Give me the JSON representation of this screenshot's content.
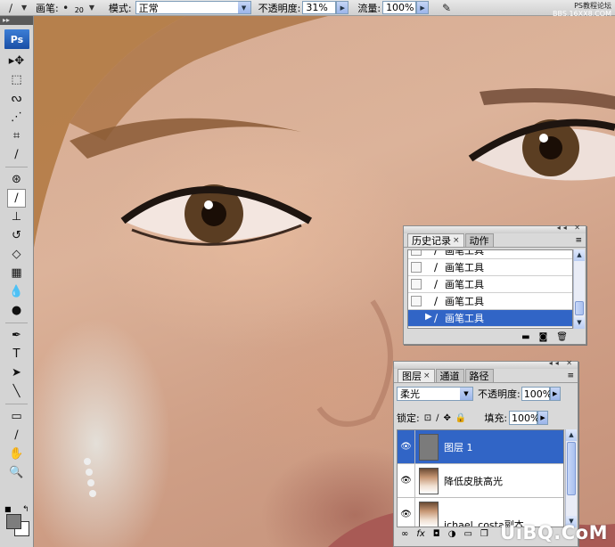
{
  "options_bar": {
    "tool_icon": "brush-icon",
    "brush_label": "画笔:",
    "brush_size": "20",
    "mode_label": "模式:",
    "mode_value": "正常",
    "opacity_label": "不透明度:",
    "opacity_value": "31%",
    "flow_label": "流量:",
    "flow_value": "100%",
    "airbrush_icon": "airbrush-icon"
  },
  "watermark_top": {
    "line1": "PS教程论坛",
    "line2": "BBS.16XX8.COM"
  },
  "tools": {
    "logo": "Ps",
    "grip": "▸▸",
    "items": [
      {
        "name": "move-tool",
        "icon": "▸✥"
      },
      {
        "name": "marquee-tool",
        "icon": "⬚"
      },
      {
        "name": "lasso-tool",
        "icon": "ᔓ"
      },
      {
        "name": "magic-wand-tool",
        "icon": "⋰"
      },
      {
        "name": "crop-tool",
        "icon": "⌗"
      },
      {
        "name": "eyedropper-tool",
        "icon": "∕"
      },
      {
        "name": "healing-tool",
        "icon": "⊛"
      },
      {
        "name": "brush-tool",
        "icon": "∕",
        "active": true
      },
      {
        "name": "stamp-tool",
        "icon": "⊥"
      },
      {
        "name": "history-brush-tool",
        "icon": "↺"
      },
      {
        "name": "eraser-tool",
        "icon": "◇"
      },
      {
        "name": "gradient-tool",
        "icon": "▦"
      },
      {
        "name": "blur-tool",
        "icon": "💧"
      },
      {
        "name": "dodge-tool",
        "icon": "●"
      },
      {
        "name": "pen-tool",
        "icon": "✒"
      },
      {
        "name": "type-tool",
        "icon": "T"
      },
      {
        "name": "path-selection-tool",
        "icon": "➤"
      },
      {
        "name": "line-tool",
        "icon": "╲"
      },
      {
        "name": "notes-tool",
        "icon": "▭"
      },
      {
        "name": "eyedropper-tool-2",
        "icon": "∕"
      },
      {
        "name": "hand-tool",
        "icon": "✋"
      },
      {
        "name": "zoom-tool",
        "icon": "🔍"
      }
    ],
    "foreground_color": "#7d7d7d",
    "background_color": "#ffffff"
  },
  "history_panel": {
    "tabs": [
      {
        "label": "历史记录",
        "active": true
      },
      {
        "label": "动作",
        "active": false
      }
    ],
    "close_glyph": "×",
    "menu_glyph": "≡",
    "items": [
      {
        "label": "画笔工具",
        "selected": false
      },
      {
        "label": "画笔工具",
        "selected": false
      },
      {
        "label": "画笔工具",
        "selected": false
      },
      {
        "label": "画笔工具",
        "selected": false
      },
      {
        "label": "画笔工具",
        "selected": true
      }
    ]
  },
  "layers_panel": {
    "tabs": [
      {
        "label": "图层",
        "active": true
      },
      {
        "label": "通道",
        "active": false
      },
      {
        "label": "路径",
        "active": false
      }
    ],
    "close_glyph": "×",
    "menu_glyph": "≡",
    "blend_mode": "柔光",
    "opacity_label": "不透明度:",
    "opacity_value": "100%",
    "lock_label": "锁定:",
    "fill_label": "填充:",
    "fill_value": "100%",
    "layers": [
      {
        "name": "图层 1",
        "selected": true,
        "thumb": "gray"
      },
      {
        "name": "降低皮肤高光",
        "selected": false,
        "thumb": "photo"
      },
      {
        "name": "ichael_costa副本",
        "selected": false,
        "thumb": "photo"
      }
    ],
    "footer_icons": [
      "link-icon",
      "fx-icon",
      "mask-icon",
      "adjustment-icon",
      "group-icon",
      "new-layer-icon"
    ]
  },
  "site_watermark": "UiBQ.CoM",
  "accent_color": "#3165c6"
}
